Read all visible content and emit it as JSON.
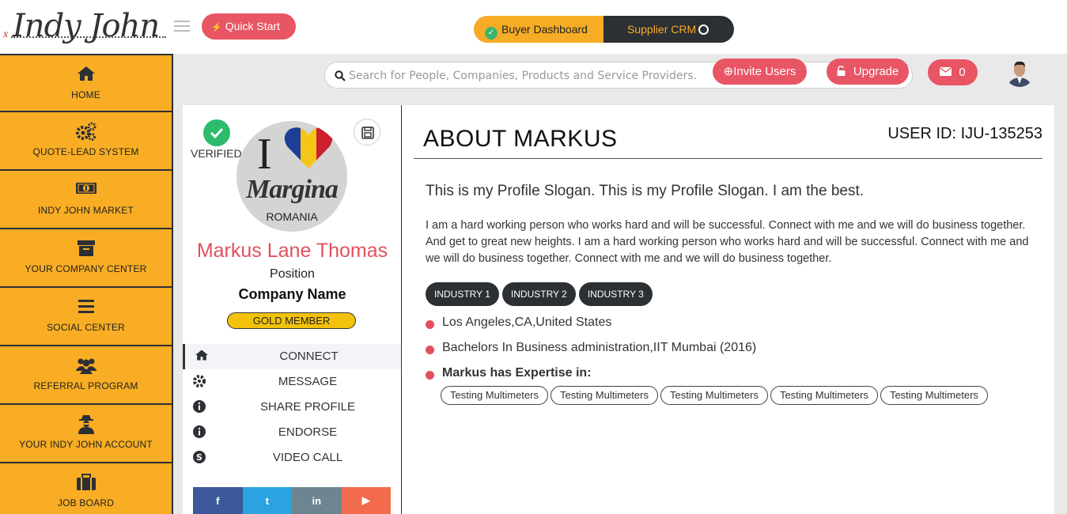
{
  "brand": {
    "logo_text": "Indy John",
    "logo_prefix": "x"
  },
  "header": {
    "quick_start": "Quick Start",
    "buyer_dashboard": "Buyer Dashboard",
    "supplier_crm": "Supplier CRM"
  },
  "sidebar": {
    "items": [
      {
        "label": "HOME",
        "icon": "home-icon"
      },
      {
        "label": "QUOTE-LEAD SYSTEM",
        "icon": "gears-icon"
      },
      {
        "label": "INDY JOHN MARKET",
        "icon": "money-icon"
      },
      {
        "label": "YOUR COMPANY CENTER",
        "icon": "archive-box-icon"
      },
      {
        "label": "SOCIAL CENTER",
        "icon": "bars-icon"
      },
      {
        "label": "REFERRAL PROGRAM",
        "icon": "users-icon"
      },
      {
        "label": "YOUR INDY JOHN ACCOUNT",
        "icon": "user-secret-icon"
      },
      {
        "label": "JOB BOARD",
        "icon": "briefcase-icon"
      }
    ]
  },
  "search": {
    "placeholder": "Search for People, Companies, Products and Service Providers."
  },
  "toolbar": {
    "invite": "Invite Users",
    "upgrade": "Upgrade",
    "message_count": "0"
  },
  "profile": {
    "verified": "VERIFIED",
    "picture": {
      "big_letter": "I",
      "word": "Margina",
      "country": "ROMANIA"
    },
    "name": "Markus Lane Thomas",
    "position": "Position",
    "company": "Company Name",
    "membership": "GOLD MEMBER",
    "actions": [
      {
        "label": "CONNECT",
        "icon": "home-icon"
      },
      {
        "label": "MESSAGE",
        "icon": "gear-icon"
      },
      {
        "label": "SHARE PROFILE",
        "icon": "info-icon"
      },
      {
        "label": "ENDORSE",
        "icon": "info-icon"
      },
      {
        "label": "VIDEO CALL",
        "icon": "skype-icon"
      }
    ],
    "social": [
      {
        "glyph": "f",
        "icon": "facebook-icon",
        "color": "#3b5998"
      },
      {
        "glyph": "t",
        "icon": "twitter-icon",
        "color": "#2aa3e0"
      },
      {
        "glyph": "in",
        "icon": "linkedin-icon",
        "color": "#6d8590"
      },
      {
        "glyph": "▶",
        "icon": "youtube-icon",
        "color": "#f26b4d"
      }
    ]
  },
  "about": {
    "title": "ABOUT MARKUS",
    "user_id": "USER ID: IJU-135253",
    "slogan": "This is my Profile Slogan. This is my Profile Slogan. I am the best.",
    "bio": "I am a hard working person who works hard and will be successful. Connect with me and we will do business together. And get to great new heights. I am a hard working person who works hard and will be successful. Connect with me and we will do business together. Connect with me and we will do business together.",
    "industries": [
      "INDUSTRY 1",
      "INDUSTRY 2",
      "INDUSTRY 3"
    ],
    "location": "Los Angeles,CA,United States",
    "education": "Bachelors In Business administration,IIT Mumbai (2016)",
    "expertise_title": "Markus has Expertise in:",
    "expertise": [
      "Testing Multimeters",
      "Testing Multimeters",
      "Testing Multimeters",
      "Testing Multimeters",
      "Testing Multimeters"
    ]
  },
  "colors": {
    "accent": "#e85564",
    "sidebar": "#f8ad24",
    "dark": "#2c2f33",
    "gold": "#f2c20c",
    "verified": "#2dbb6c"
  }
}
